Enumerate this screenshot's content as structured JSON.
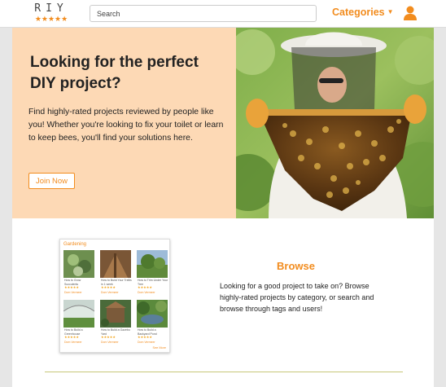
{
  "header": {
    "logo_text": "RIY",
    "logo_stars": "★★★★★",
    "search_placeholder": "Search",
    "categories_label": "Categories",
    "categories_caret": "▼",
    "user_icon": "user-icon"
  },
  "hero": {
    "title": "Looking for the perfect DIY project?",
    "description": "Find highly-rated projects reviewed by people like you! Whether you're looking to fix your toilet or learn to keep bees, you'll find your solutions here.",
    "join_label": "Join Now"
  },
  "preview": {
    "category_title": "Gardening",
    "see_more": "See More",
    "cards": [
      {
        "title": "How to Grow Succulents",
        "stars": "★★★★★",
        "user": "Dom Vermeer"
      },
      {
        "title": "How to Build Your Trellis in 1 week",
        "stars": "★★★★★",
        "user": "Dom Vermeer"
      },
      {
        "title": "How to Trim Under Your Tree",
        "stars": "★★★★★",
        "user": "Dom Vermeer"
      },
      {
        "title": "How to Build a Greenhouse",
        "stars": "★★★★★",
        "user": "Dom Vermeer"
      },
      {
        "title": "How to Build a Gazebo Yard",
        "stars": "★★★★★",
        "user": "Dom Vermeer"
      },
      {
        "title": "How to Build a Backyard Pond",
        "stars": "★★★★★",
        "user": "Dom Vermeer"
      }
    ]
  },
  "browse": {
    "title": "Browse",
    "description": "Looking for a good project to take on? Browse highly-rated projects by category, or search and browse through tags and users!"
  },
  "colors": {
    "accent": "#f28c1e",
    "hero_bg": "#fdd9b5",
    "divider": "#c8c879"
  }
}
